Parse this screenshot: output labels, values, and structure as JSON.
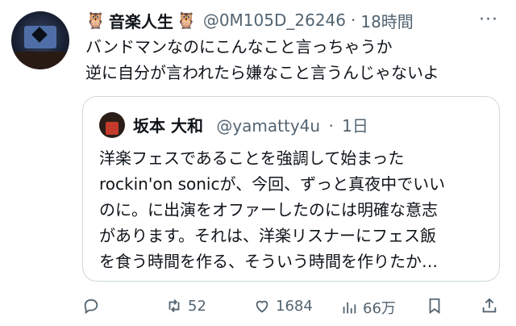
{
  "tweet": {
    "author_name": "音楽人生",
    "owl_left": "🦉",
    "owl_right": "🦉",
    "handle": "@0M105D_26246",
    "separator": "·",
    "time": "18時間",
    "more": "···",
    "lines": [
      "バンドマンなのにこんなこと言っちゃうか",
      "逆に自分が言われたら嫌なこと言うんじゃないよ"
    ]
  },
  "quote": {
    "author_name": "坂本 大和",
    "handle": "@yamatty4u",
    "separator": "·",
    "time": "1日",
    "lines": [
      "洋楽フェスであることを強調して始まった",
      "rockin'on sonicが、今回、ずっと真夜中でいい",
      "のに。に出演をオファーしたのには明確な意志",
      "があります。それは、洋楽リスナーにフェス飯",
      "を食う時間を作る、そういう時間を作りたか…"
    ]
  },
  "actions": {
    "reply_icon": "reply-icon",
    "retweet_icon": "retweet-icon",
    "retweet_count": "52",
    "like_icon": "heart-icon",
    "like_count": "1684",
    "views_icon": "views-icon",
    "views_count": "66万",
    "bookmark_icon": "bookmark-icon",
    "share_icon": "share-icon"
  }
}
